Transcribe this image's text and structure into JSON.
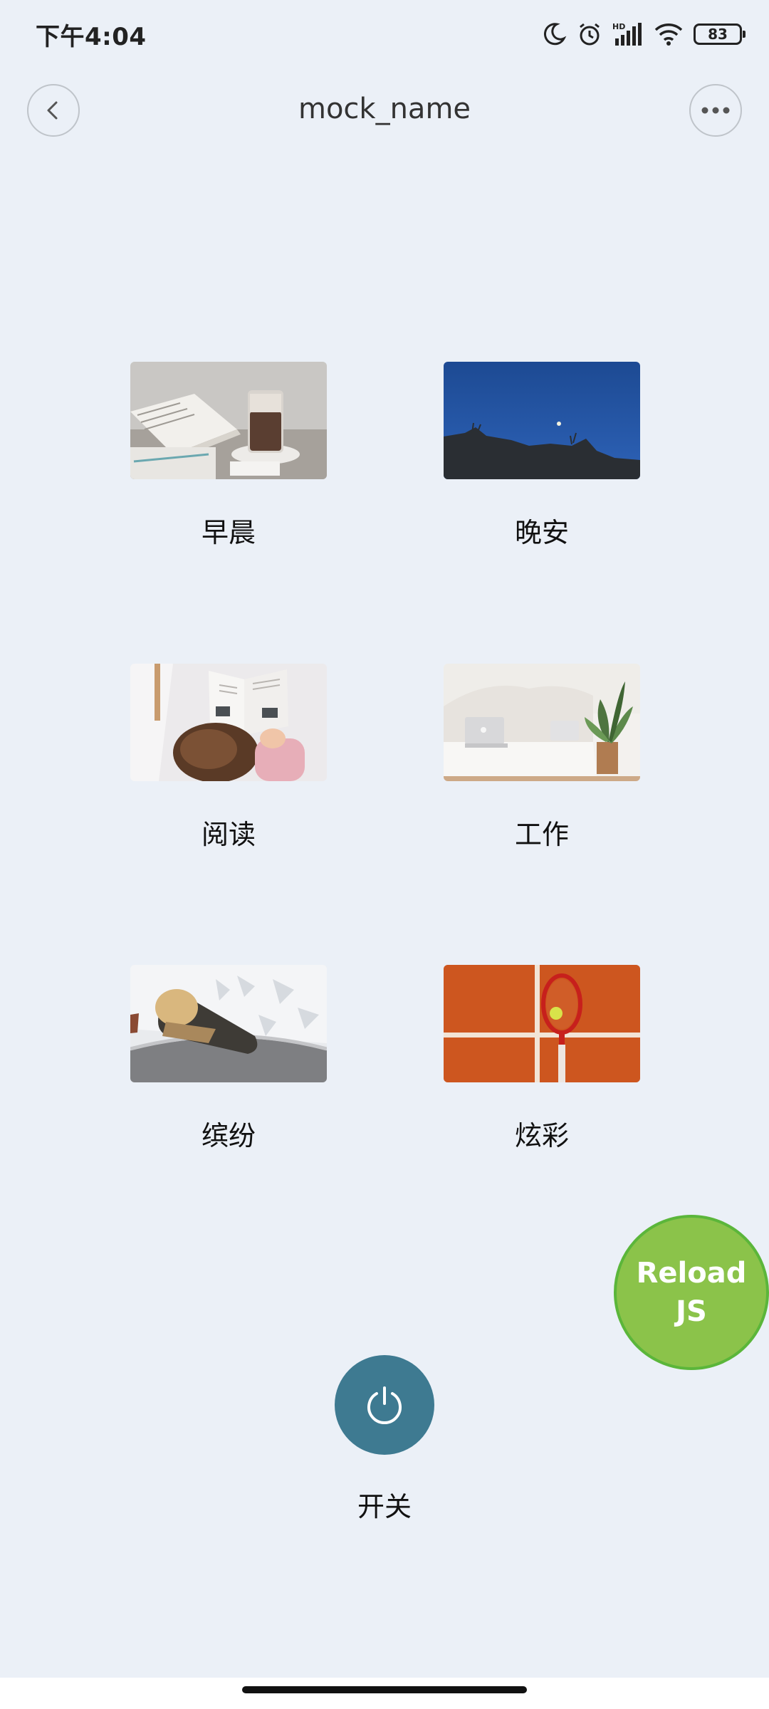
{
  "status_bar": {
    "time": "下午4:04",
    "battery": "83",
    "icons": [
      "moon-icon",
      "alarm-icon",
      "hd-signal-icon",
      "wifi-icon",
      "battery-icon"
    ]
  },
  "header": {
    "title": "mock_name",
    "back_icon": "chevron-left-icon",
    "more_icon": "more-dots-icon"
  },
  "scenes": [
    {
      "label": "早晨",
      "image": "coffee-and-book-photo"
    },
    {
      "label": "晚安",
      "image": "night-sky-moon-photo"
    },
    {
      "label": "阅读",
      "image": "person-reading-book-photo"
    },
    {
      "label": "工作",
      "image": "laptop-on-sofa-photo"
    },
    {
      "label": "缤纷",
      "image": "champagne-in-ice-photo"
    },
    {
      "label": "炫彩",
      "image": "tennis-racket-on-court-photo"
    }
  ],
  "power": {
    "label": "开关",
    "icon": "power-icon"
  },
  "reload": {
    "line1": "Reload",
    "line2": "JS"
  },
  "colors": {
    "background": "#EBF0F7",
    "power_button": "#3E7A91",
    "reload_button": "#8BC34A"
  }
}
